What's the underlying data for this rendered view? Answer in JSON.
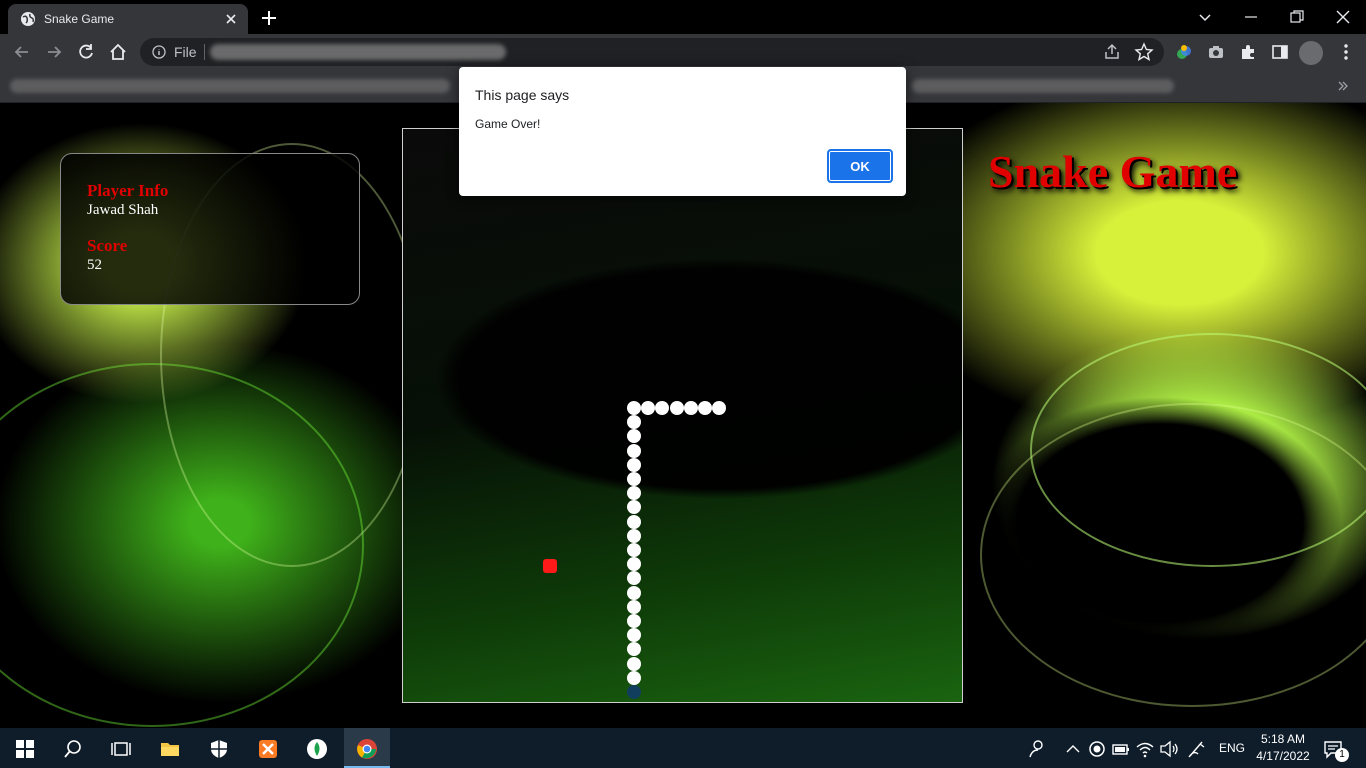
{
  "browser": {
    "tab_title": "Snake Game",
    "omnibox_scheme": "File"
  },
  "page": {
    "player_info_label": "Player Info",
    "player_name": "Jawad Shah",
    "score_label": "Score",
    "score_value": "52",
    "game_title": "Snake Game"
  },
  "alert": {
    "heading": "This page says",
    "message": "Game Over!",
    "ok_label": "OK"
  },
  "taskbar": {
    "language": "ENG",
    "time": "5:18 AM",
    "date": "4/17/2022",
    "notification_count": "1"
  },
  "colors": {
    "accent_red": "#e00000",
    "snake": "#ffffff",
    "food": "#ff1a1a",
    "ok_button": "#1a73e8"
  }
}
